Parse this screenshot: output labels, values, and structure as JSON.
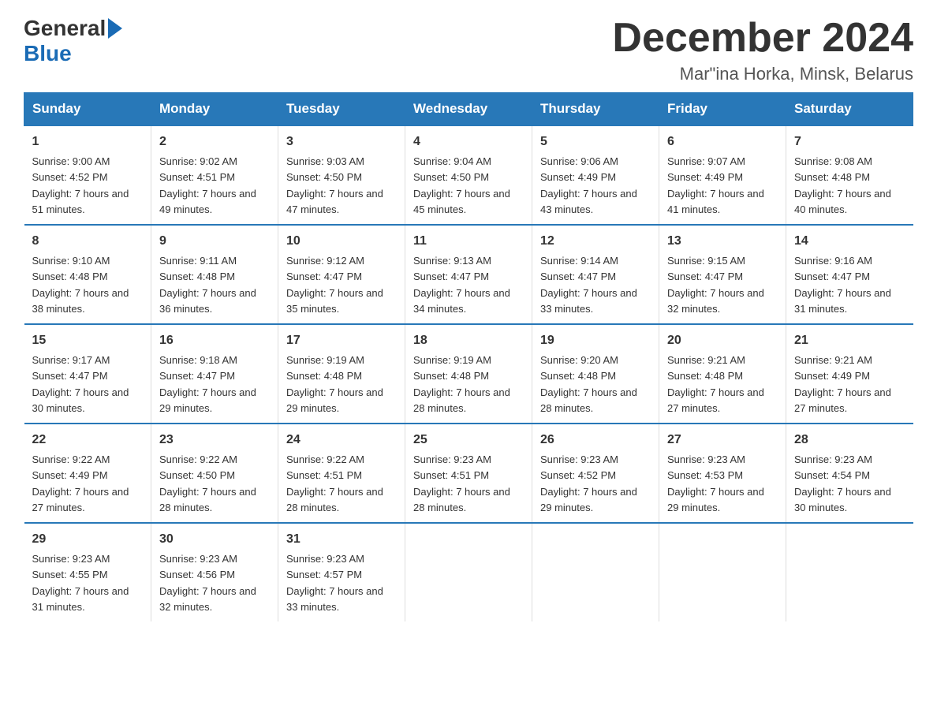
{
  "logo": {
    "general": "General",
    "blue": "Blue"
  },
  "title": "December 2024",
  "location": "Mar\"ina Horka, Minsk, Belarus",
  "days_of_week": [
    "Sunday",
    "Monday",
    "Tuesday",
    "Wednesday",
    "Thursday",
    "Friday",
    "Saturday"
  ],
  "weeks": [
    [
      {
        "day": "1",
        "sunrise": "Sunrise: 9:00 AM",
        "sunset": "Sunset: 4:52 PM",
        "daylight": "Daylight: 7 hours and 51 minutes."
      },
      {
        "day": "2",
        "sunrise": "Sunrise: 9:02 AM",
        "sunset": "Sunset: 4:51 PM",
        "daylight": "Daylight: 7 hours and 49 minutes."
      },
      {
        "day": "3",
        "sunrise": "Sunrise: 9:03 AM",
        "sunset": "Sunset: 4:50 PM",
        "daylight": "Daylight: 7 hours and 47 minutes."
      },
      {
        "day": "4",
        "sunrise": "Sunrise: 9:04 AM",
        "sunset": "Sunset: 4:50 PM",
        "daylight": "Daylight: 7 hours and 45 minutes."
      },
      {
        "day": "5",
        "sunrise": "Sunrise: 9:06 AM",
        "sunset": "Sunset: 4:49 PM",
        "daylight": "Daylight: 7 hours and 43 minutes."
      },
      {
        "day": "6",
        "sunrise": "Sunrise: 9:07 AM",
        "sunset": "Sunset: 4:49 PM",
        "daylight": "Daylight: 7 hours and 41 minutes."
      },
      {
        "day": "7",
        "sunrise": "Sunrise: 9:08 AM",
        "sunset": "Sunset: 4:48 PM",
        "daylight": "Daylight: 7 hours and 40 minutes."
      }
    ],
    [
      {
        "day": "8",
        "sunrise": "Sunrise: 9:10 AM",
        "sunset": "Sunset: 4:48 PM",
        "daylight": "Daylight: 7 hours and 38 minutes."
      },
      {
        "day": "9",
        "sunrise": "Sunrise: 9:11 AM",
        "sunset": "Sunset: 4:48 PM",
        "daylight": "Daylight: 7 hours and 36 minutes."
      },
      {
        "day": "10",
        "sunrise": "Sunrise: 9:12 AM",
        "sunset": "Sunset: 4:47 PM",
        "daylight": "Daylight: 7 hours and 35 minutes."
      },
      {
        "day": "11",
        "sunrise": "Sunrise: 9:13 AM",
        "sunset": "Sunset: 4:47 PM",
        "daylight": "Daylight: 7 hours and 34 minutes."
      },
      {
        "day": "12",
        "sunrise": "Sunrise: 9:14 AM",
        "sunset": "Sunset: 4:47 PM",
        "daylight": "Daylight: 7 hours and 33 minutes."
      },
      {
        "day": "13",
        "sunrise": "Sunrise: 9:15 AM",
        "sunset": "Sunset: 4:47 PM",
        "daylight": "Daylight: 7 hours and 32 minutes."
      },
      {
        "day": "14",
        "sunrise": "Sunrise: 9:16 AM",
        "sunset": "Sunset: 4:47 PM",
        "daylight": "Daylight: 7 hours and 31 minutes."
      }
    ],
    [
      {
        "day": "15",
        "sunrise": "Sunrise: 9:17 AM",
        "sunset": "Sunset: 4:47 PM",
        "daylight": "Daylight: 7 hours and 30 minutes."
      },
      {
        "day": "16",
        "sunrise": "Sunrise: 9:18 AM",
        "sunset": "Sunset: 4:47 PM",
        "daylight": "Daylight: 7 hours and 29 minutes."
      },
      {
        "day": "17",
        "sunrise": "Sunrise: 9:19 AM",
        "sunset": "Sunset: 4:48 PM",
        "daylight": "Daylight: 7 hours and 29 minutes."
      },
      {
        "day": "18",
        "sunrise": "Sunrise: 9:19 AM",
        "sunset": "Sunset: 4:48 PM",
        "daylight": "Daylight: 7 hours and 28 minutes."
      },
      {
        "day": "19",
        "sunrise": "Sunrise: 9:20 AM",
        "sunset": "Sunset: 4:48 PM",
        "daylight": "Daylight: 7 hours and 28 minutes."
      },
      {
        "day": "20",
        "sunrise": "Sunrise: 9:21 AM",
        "sunset": "Sunset: 4:48 PM",
        "daylight": "Daylight: 7 hours and 27 minutes."
      },
      {
        "day": "21",
        "sunrise": "Sunrise: 9:21 AM",
        "sunset": "Sunset: 4:49 PM",
        "daylight": "Daylight: 7 hours and 27 minutes."
      }
    ],
    [
      {
        "day": "22",
        "sunrise": "Sunrise: 9:22 AM",
        "sunset": "Sunset: 4:49 PM",
        "daylight": "Daylight: 7 hours and 27 minutes."
      },
      {
        "day": "23",
        "sunrise": "Sunrise: 9:22 AM",
        "sunset": "Sunset: 4:50 PM",
        "daylight": "Daylight: 7 hours and 28 minutes."
      },
      {
        "day": "24",
        "sunrise": "Sunrise: 9:22 AM",
        "sunset": "Sunset: 4:51 PM",
        "daylight": "Daylight: 7 hours and 28 minutes."
      },
      {
        "day": "25",
        "sunrise": "Sunrise: 9:23 AM",
        "sunset": "Sunset: 4:51 PM",
        "daylight": "Daylight: 7 hours and 28 minutes."
      },
      {
        "day": "26",
        "sunrise": "Sunrise: 9:23 AM",
        "sunset": "Sunset: 4:52 PM",
        "daylight": "Daylight: 7 hours and 29 minutes."
      },
      {
        "day": "27",
        "sunrise": "Sunrise: 9:23 AM",
        "sunset": "Sunset: 4:53 PM",
        "daylight": "Daylight: 7 hours and 29 minutes."
      },
      {
        "day": "28",
        "sunrise": "Sunrise: 9:23 AM",
        "sunset": "Sunset: 4:54 PM",
        "daylight": "Daylight: 7 hours and 30 minutes."
      }
    ],
    [
      {
        "day": "29",
        "sunrise": "Sunrise: 9:23 AM",
        "sunset": "Sunset: 4:55 PM",
        "daylight": "Daylight: 7 hours and 31 minutes."
      },
      {
        "day": "30",
        "sunrise": "Sunrise: 9:23 AM",
        "sunset": "Sunset: 4:56 PM",
        "daylight": "Daylight: 7 hours and 32 minutes."
      },
      {
        "day": "31",
        "sunrise": "Sunrise: 9:23 AM",
        "sunset": "Sunset: 4:57 PM",
        "daylight": "Daylight: 7 hours and 33 minutes."
      },
      {
        "day": "",
        "sunrise": "",
        "sunset": "",
        "daylight": ""
      },
      {
        "day": "",
        "sunrise": "",
        "sunset": "",
        "daylight": ""
      },
      {
        "day": "",
        "sunrise": "",
        "sunset": "",
        "daylight": ""
      },
      {
        "day": "",
        "sunrise": "",
        "sunset": "",
        "daylight": ""
      }
    ]
  ]
}
